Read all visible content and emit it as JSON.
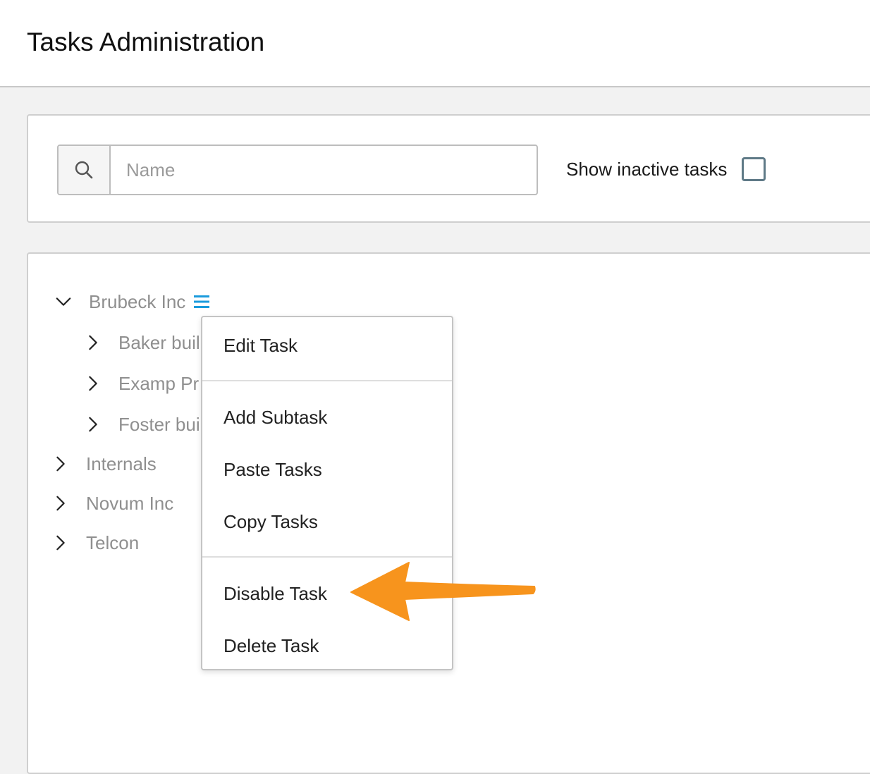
{
  "page": {
    "title": "Tasks Administration"
  },
  "filter": {
    "search_icon": "search-icon",
    "search_placeholder": "Name",
    "search_value": "",
    "show_inactive_label": "Show inactive tasks",
    "show_inactive_checked": false
  },
  "tree": {
    "items": [
      {
        "label": "Brubeck Inc",
        "expanded": true,
        "level": 0
      },
      {
        "label": "Baker buil",
        "expanded": false,
        "level": 1
      },
      {
        "label": "Examp Pr",
        "expanded": false,
        "level": 1
      },
      {
        "label": "Foster bui",
        "expanded": false,
        "level": 1
      },
      {
        "label": "Internals",
        "expanded": false,
        "level": 0
      },
      {
        "label": "Novum Inc",
        "expanded": false,
        "level": 0
      },
      {
        "label": "Telcon",
        "expanded": false,
        "level": 0
      }
    ],
    "menu_icon": "hamburger-menu-icon"
  },
  "context_menu": {
    "items": [
      {
        "label": "Edit Task"
      },
      {
        "label": "Add Subtask"
      },
      {
        "label": "Paste Tasks"
      },
      {
        "label": "Copy Tasks"
      },
      {
        "label": "Disable Task"
      },
      {
        "label": "Delete Task"
      }
    ]
  },
  "colors": {
    "accent": "#1a9bdc",
    "annotation_arrow": "#f7941d",
    "tree_text": "#8f8f8f",
    "checkbox_border": "#5f7a87",
    "background": "#f2f2f2"
  }
}
